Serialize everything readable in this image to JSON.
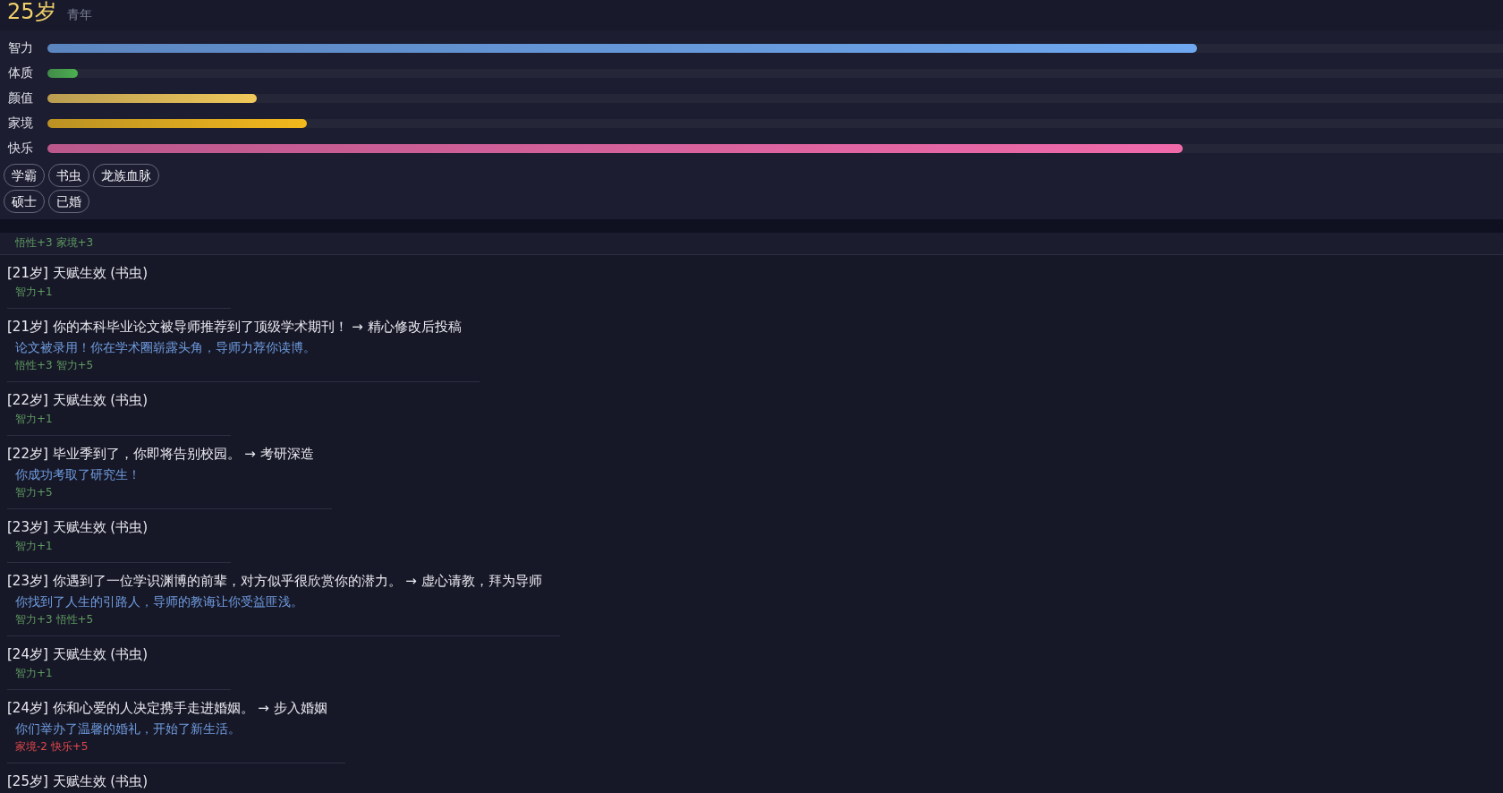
{
  "header": {
    "age": "25岁",
    "stage": "青年"
  },
  "stats": [
    {
      "label": "智力",
      "level": 0.79,
      "color": "#6fa8f0"
    },
    {
      "label": "体质",
      "level": 0.021,
      "color": "#4caf50"
    },
    {
      "label": "颜值",
      "level": 0.144,
      "color": "#f0c85a"
    },
    {
      "label": "家境",
      "level": 0.178,
      "color": "#f2b81c"
    },
    {
      "label": "快乐",
      "level": 0.78,
      "color": "#f06aaa"
    }
  ],
  "tags": [
    [
      "学霸",
      "书虫",
      "龙族血脉"
    ],
    [
      "硕士",
      "已婚"
    ]
  ],
  "log": [
    {
      "effects": "悟性+3 家境+3",
      "color": "#5f9c62"
    },
    {
      "title": "[21岁] 天赋生效 (书虫)",
      "effects": "智力+1",
      "color": "#5f9c62"
    },
    {
      "title": "[21岁] 你的本科毕业论文被导师推荐到了顶级学术期刊！ → 精心修改后投稿",
      "outcome": "论文被录用！你在学术圈崭露头角，导师力荐你读博。",
      "effects": "悟性+3 智力+5",
      "color": "#5f9c62"
    },
    {
      "title": "[22岁] 天赋生效 (书虫)",
      "effects": "智力+1",
      "color": "#5f9c62"
    },
    {
      "title": "[22岁] 毕业季到了，你即将告别校园。 → 考研深造",
      "outcome": "你成功考取了研究生！",
      "effects": "智力+5",
      "color": "#5f9c62"
    },
    {
      "title": "[23岁] 天赋生效 (书虫)",
      "effects": "智力+1",
      "color": "#5f9c62"
    },
    {
      "title": "[23岁] 你遇到了一位学识渊博的前辈，对方似乎很欣赏你的潜力。 → 虚心请教，拜为导师",
      "outcome": "你找到了人生的引路人，导师的教诲让你受益匪浅。",
      "effects": "智力+3 悟性+5",
      "color": "#5f9c62"
    },
    {
      "title": "[24岁] 天赋生效 (书虫)",
      "effects": "智力+1",
      "color": "#5f9c62"
    },
    {
      "title": "[24岁] 你和心爱的人决定携手走进婚姻。 → 步入婚姻",
      "outcome": "你们举办了温馨的婚礼，开始了新生活。",
      "effects": "家境-2 快乐+5",
      "color": "#e0474c"
    },
    {
      "title": "[25岁] 天赋生效 (书虫)"
    }
  ]
}
